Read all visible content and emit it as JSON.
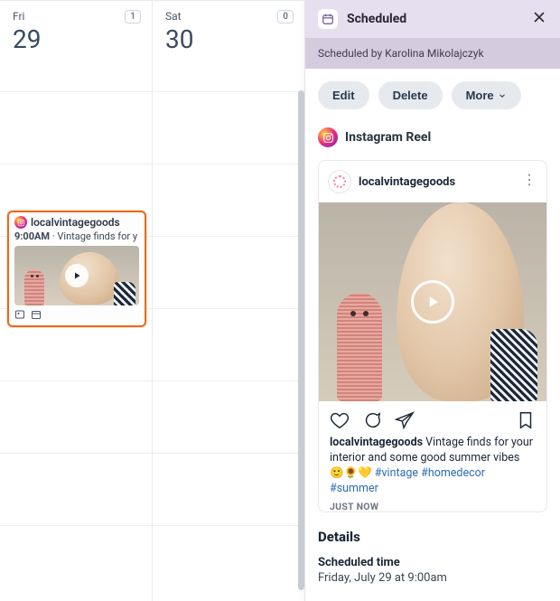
{
  "calendar": {
    "days": [
      {
        "name": "Fri",
        "num": "29",
        "badge": "1"
      },
      {
        "name": "Sat",
        "num": "30",
        "badge": "0"
      }
    ],
    "event": {
      "account": "localvintagegoods",
      "time": "9:00AM",
      "sep": " · ",
      "snippet": "Vintage finds for y"
    }
  },
  "panel": {
    "title": "Scheduled",
    "scheduled_by": "Scheduled by Karolina Mikolajczyk",
    "actions": {
      "edit": "Edit",
      "delete": "Delete",
      "more": "More"
    },
    "post_type": "Instagram Reel",
    "post": {
      "account": "localvintagegoods",
      "caption_account": "localvintagegoods",
      "caption_text": "Vintage finds for your interior and some good summer vibes 🙂🌻💛 ",
      "hashtags": "#vintage #homedecor #summer",
      "timestamp": "JUST NOW"
    },
    "details": {
      "heading": "Details",
      "scheduled_time_label": "Scheduled time",
      "scheduled_time_value": "Friday, July 29 at 9:00am"
    }
  }
}
